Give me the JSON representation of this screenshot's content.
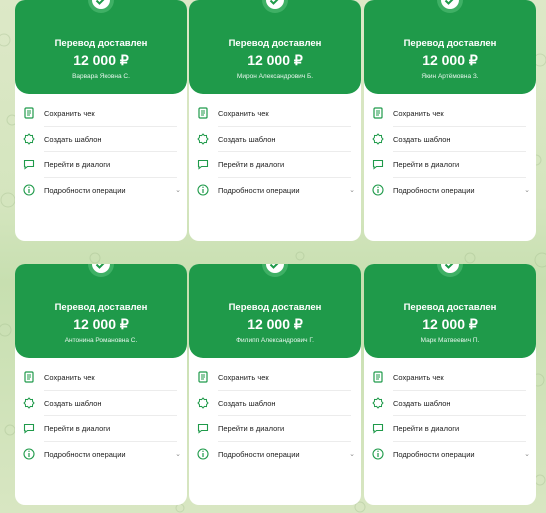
{
  "colors": {
    "accent": "#1f9a4a",
    "text": "#1d1d1d",
    "background": "#dde8c7"
  },
  "actions": {
    "save": {
      "label": "Сохранить чек",
      "icon": "receipt-icon"
    },
    "template": {
      "label": "Создать шаблон",
      "icon": "badge-star-icon"
    },
    "dialog": {
      "label": "Перейти в диалоги",
      "icon": "chat-icon"
    },
    "details": {
      "label": "Подробности операции",
      "icon": "info-icon",
      "chevron": "⌄"
    }
  },
  "cards": [
    {
      "title": "Перевод доставлен",
      "amount": "12 000 ₽",
      "recipient": "Варвара Яковна С."
    },
    {
      "title": "Перевод доставлен",
      "amount": "12 000 ₽",
      "recipient": "Мирон Александрович Б."
    },
    {
      "title": "Перевод доставлен",
      "amount": "12 000 ₽",
      "recipient": "Якин Артёмовна З."
    },
    {
      "title": "Перевод доставлен",
      "amount": "12 000 ₽",
      "recipient": "Антонина Романовна С."
    },
    {
      "title": "Перевод доставлен",
      "amount": "12 000 ₽",
      "recipient": "Филипп Александрович Г."
    },
    {
      "title": "Перевод доставлен",
      "amount": "12 000 ₽",
      "recipient": "Марк Матвеевич П."
    }
  ]
}
